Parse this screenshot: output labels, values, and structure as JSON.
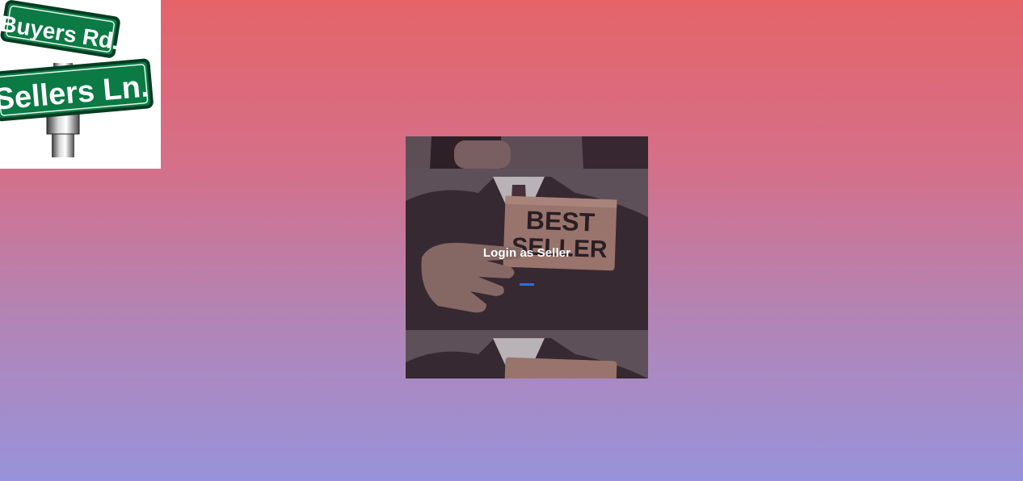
{
  "logo": {
    "line1": "Buyers Rd.",
    "line2": "Sellers Ln."
  },
  "photo": {
    "sign_line1": "BEST",
    "sign_line2": "SELLER"
  },
  "login": {
    "label": "Login as Seller"
  },
  "colors": {
    "gradient_top": "#e56469",
    "gradient_bottom": "#9893d9",
    "sign_green": "#0b7a45",
    "underline_accent": "#2f6fd6"
  }
}
